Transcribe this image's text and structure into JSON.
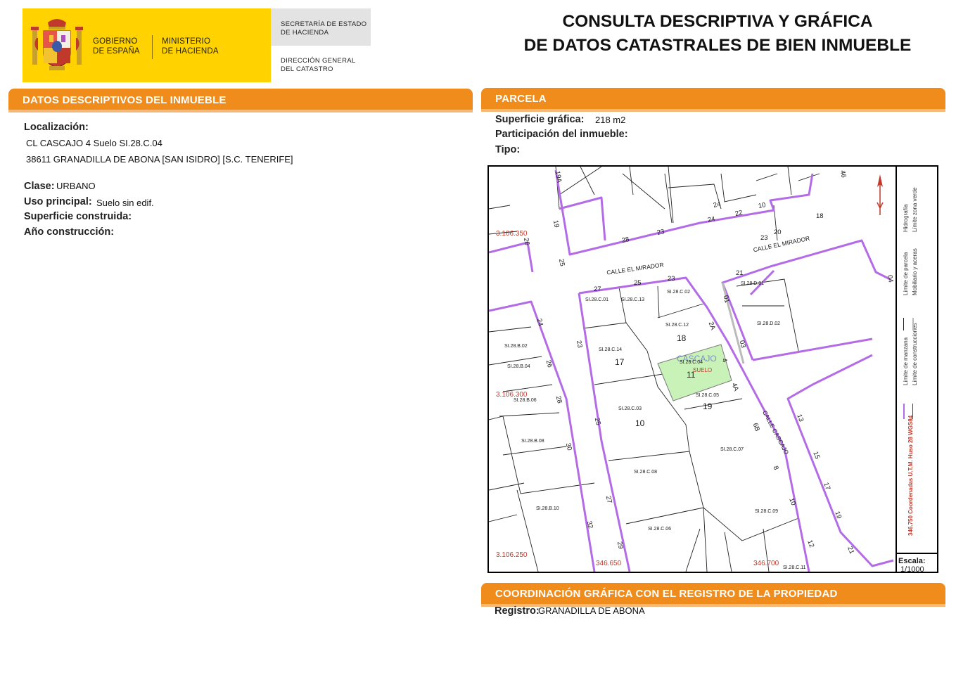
{
  "header": {
    "gobierno": [
      "GOBIERNO",
      "DE ESPAÑA"
    ],
    "ministerio": [
      "MINISTERIO",
      "DE HACIENDA"
    ],
    "secretaria": [
      "SECRETARÍA DE ESTADO",
      "DE HACIENDA"
    ],
    "direccion": [
      "DIRECCIÓN GENERAL",
      "DEL CATASTRO"
    ],
    "title_line1": "CONSULTA DESCRIPTIVA Y GRÁFICA",
    "title_line2": "DE DATOS CATASTRALES DE BIEN INMUEBLE"
  },
  "descriptivos": {
    "section_title": "DATOS DESCRIPTIVOS DEL INMUEBLE",
    "localizacion_label": "Localización:",
    "localizacion_line1": "CL CASCAJO 4 Suelo SI.28.C.04",
    "localizacion_line2": "38611 GRANADILLA DE ABONA [SAN ISIDRO] [S.C. TENERIFE]",
    "clase_label": "Clase:",
    "clase_value": "URBANO",
    "uso_label": "Uso principal:",
    "uso_value": "Suelo sin edif.",
    "superficie_label": "Superficie construida:",
    "anio_label": "Año construcción:"
  },
  "parcela": {
    "section_title": "PARCELA",
    "superficie_label": "Superficie gráfica:",
    "superficie_value": "218 m2",
    "participacion_label": "Participación del inmueble:",
    "tipo_label": "Tipo:"
  },
  "map": {
    "scale_label": "Escala:",
    "scale_value": "1/1000",
    "coord_note": "346.750 Coordenadas U.T.M. Huso 28 WGS84",
    "coords": [
      "3.106.350",
      "3.106.300",
      "3.106.250",
      "346.650",
      "346.700"
    ],
    "legend": [
      "Límite de manzana",
      "Límite de construcciones",
      "Límite de parcela",
      "Mobiliario y aceras",
      "Hidrografía",
      "Límite zona verde"
    ],
    "streets": [
      "CALLE EL MIRADOR",
      "CALLE EL MIRADOR",
      "CALLE CASCAJO"
    ],
    "highlight_ref": "SI.28.C.04",
    "highlight_label": "SUELO",
    "highlight_number": "11",
    "highlight_street": "CASCAJO",
    "parcel_refs": [
      "SI.28.C.01",
      "SI.28.C.13",
      "SI.28.C.02",
      "SI.28.C.12",
      "SI.28.C.14",
      "SI.28.C.05",
      "SI.28.C.03",
      "SI.28.C.07",
      "SI.28.C.08",
      "SI.28.C.09",
      "SI.28.C.06",
      "SI.28.C.11",
      "SI.28.D.01",
      "SI.28.D.02",
      "SI.28.B.02",
      "SI.28.B.04",
      "SI.28.B.06",
      "SI.28.B.08",
      "SI.28.B.10"
    ],
    "parcel_numbers": [
      "18",
      "17",
      "19",
      "10"
    ],
    "portal_numbers": [
      "19A",
      "19",
      "26",
      "25",
      "25",
      "27",
      "23",
      "23",
      "24",
      "28",
      "24",
      "22",
      "10",
      "20",
      "18",
      "23",
      "21",
      "01",
      "2A",
      "03",
      "4",
      "4A",
      "6B",
      "8",
      "10",
      "12",
      "13",
      "15",
      "17",
      "19",
      "21",
      "24",
      "26",
      "28",
      "30",
      "32",
      "23",
      "25",
      "27",
      "29",
      "46",
      "04"
    ]
  },
  "registro": {
    "section_title": "COORDINACIÓN GRÁFICA CON EL REGISTRO DE LA PROPIEDAD",
    "label": "Registro:",
    "value": "GRANADILLA DE ABONA"
  },
  "colors": {
    "orange": "#f08c1c",
    "yellow": "#ffd200",
    "purple": "#b36be6",
    "green": "#c8f2b8",
    "red": "#c0392b"
  },
  "icons": [
    "coat-of-arms-icon",
    "north-arrow-icon"
  ]
}
